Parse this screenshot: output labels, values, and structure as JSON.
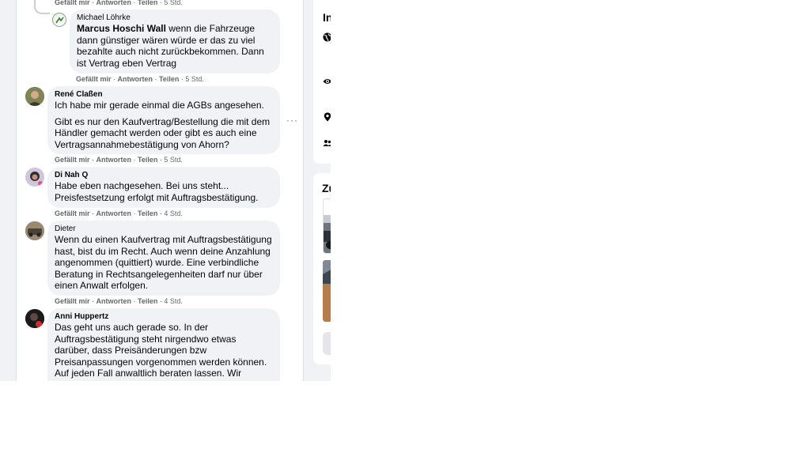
{
  "top_actions": {
    "like": "Gefällt mir",
    "reply": "Antworten",
    "share": "Teilen",
    "time": "5 Std."
  },
  "comments": [
    {
      "author": "Michael Löhrke",
      "mention": "Marcus Hoschi Wall",
      "text": "wenn die Fahrzeuge dann günstiger wären würde er das zu viel bezahlte auch nicht zurückbekommen. Dann ist Vertrag eben Vertrag",
      "like": "Gefällt mir",
      "reply": "Antworten",
      "share": "Teilen",
      "time": "5 Std."
    },
    {
      "author": "René Claßen",
      "text1": "Ich habe mir gerade einmal die AGBs angesehen.",
      "text2": "Gibt es nur den Kaufvertrag/Bestellung die mit dem Händler gemacht werden oder gibt es auch eine Vertragsannahmebestätigung von Ahorn?",
      "like": "Gefällt mir",
      "reply": "Antworten",
      "share": "Teilen",
      "time": "5 Std.",
      "more_icon": "more-horizontal-icon"
    },
    {
      "author": "Di Nah Q",
      "text": "Habe eben nachgesehen. Bei uns steht... Preisfestsetzung erfolgt mit Auftragsbestätigung.",
      "like": "Gefällt mir",
      "reply": "Antworten",
      "share": "Teilen",
      "time": "4 Std."
    },
    {
      "author": "Dieter",
      "text": "Wenn du einen Kaufvertrag mit Auftragsbestätigung hast, bist du im Recht. Auch wenn deine Anzahlung angenommen (quittiert) wurde. Eine verbindliche Beratung in Rechtsangelegenheiten darf nur über einen Anwalt erfolgen.",
      "like": "Gefällt mir",
      "reply": "Antworten",
      "share": "Teilen",
      "time": "4 Std."
    },
    {
      "author": "Anni Huppertz",
      "text": "Das geht uns auch gerade so. In der Auftragsbestätigung steht nirgendwo etwas darüber, dass Preisänderungen bzw Preisanpassungen vorgenommen werden können. Auf jeden Fall anwaltlich beraten lassen. Wir unterschreiben den neuen Vertrag erstmal überhaupt..."
    }
  ],
  "sidebar": {
    "info_title": "In",
    "info_icons": [
      "globe-icon",
      "eye-icon",
      "location-pin-icon",
      "group-icon"
    ],
    "related_title": "Zu"
  },
  "colors": {
    "page_bg": "#f0f2f5",
    "bubble_bg": "#f0f2f5",
    "secondary_text": "#65676b"
  }
}
